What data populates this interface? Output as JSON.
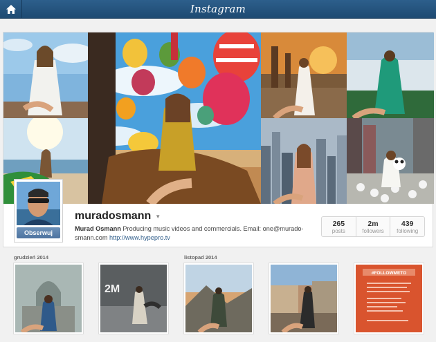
{
  "app": {
    "brand": "Instagram"
  },
  "icons": {
    "home": "home-icon",
    "dropdown": "chevron-down-icon"
  },
  "colors": {
    "topbar": "#2d5f8c",
    "follow_button": "#5a7ea8",
    "link": "#2f5d8a"
  },
  "profile": {
    "username": "muradosmann",
    "full_name": "Murad Osmann",
    "bio_text": " Producing music videos and commercials. Email: one@murado-smann.com ",
    "website": "http://www.hypepro.tv",
    "follow_label": "Obserwuj",
    "stats": [
      {
        "value": "265",
        "label": "posts"
      },
      {
        "value": "2m",
        "label": "followers"
      },
      {
        "value": "439",
        "label": "following"
      }
    ]
  },
  "feed": {
    "months": [
      "grudzień 2014",
      "listopad 2014"
    ],
    "thumb4_text": "2M",
    "thumb5_tag": "#FOLLOWMETO"
  }
}
